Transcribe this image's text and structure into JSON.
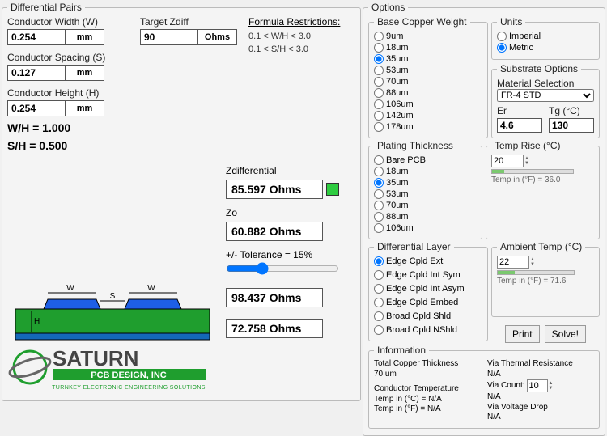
{
  "diffpairs": {
    "legend": "Differential Pairs",
    "conductor_width_label": "Conductor Width (W)",
    "conductor_width_value": "0.254",
    "conductor_width_unit": "mm",
    "target_zdiff_label": "Target Zdiff",
    "target_zdiff_value": "90",
    "target_zdiff_unit": "Ohms",
    "conductor_spacing_label": "Conductor Spacing (S)",
    "conductor_spacing_value": "0.127",
    "conductor_spacing_unit": "mm",
    "conductor_height_label": "Conductor Height (H)",
    "conductor_height_value": "0.254",
    "conductor_height_unit": "mm",
    "formula_header": "Formula Restrictions:",
    "formula_line1": "0.1 < W/H < 3.0",
    "formula_line2": "0.1 < S/H < 3.0",
    "wh_ratio": "W/H = 1.000",
    "sh_ratio": "S/H =  0.500",
    "zdiff_label": "Zdifferential",
    "zdiff_value": "85.597 Ohms",
    "zo_label": "Zo",
    "zo_value": "60.882 Ohms",
    "tolerance_label": "+/- Tolerance = 15%",
    "upper_value": "98.437 Ohms",
    "lower_value": "72.758 Ohms"
  },
  "options": {
    "legend": "Options",
    "base_copper_legend": "Base Copper Weight",
    "base_copper_items": [
      "9um",
      "18um",
      "35um",
      "53um",
      "70um",
      "88um",
      "106um",
      "142um",
      "178um"
    ],
    "base_copper_selected": "35um",
    "units_legend": "Units",
    "units_items": [
      "Imperial",
      "Metric"
    ],
    "units_selected": "Metric",
    "substrate_legend": "Substrate Options",
    "material_label": "Material Selection",
    "material_value": "FR-4 STD",
    "er_label": "Er",
    "er_value": "4.6",
    "tg_label": "Tg (°C)",
    "tg_value": "130",
    "plating_legend": "Plating Thickness",
    "plating_items": [
      "Bare PCB",
      "18um",
      "35um",
      "53um",
      "70um",
      "88um",
      "106um"
    ],
    "plating_selected": "35um",
    "temp_rise_legend": "Temp Rise (°C)",
    "temp_rise_value": "20",
    "temp_rise_note": "Temp in (°F) = 36.0",
    "diff_layer_legend": "Differential Layer",
    "diff_layer_items": [
      "Edge Cpld Ext",
      "Edge Cpld Int Sym",
      "Edge Cpld Int Asym",
      "Edge Cpld Embed",
      "Broad Cpld Shld",
      "Broad Cpld NShld"
    ],
    "diff_layer_selected": "Edge Cpld Ext",
    "ambient_legend": "Ambient Temp (°C)",
    "ambient_value": "22",
    "ambient_note": "Temp in (°F) = 71.6",
    "print_label": "Print",
    "solve_label": "Solve!",
    "info_legend": "Information",
    "info_total_copper_label": "Total Copper Thickness",
    "info_total_copper_value": "70 um",
    "info_via_thermal_label": "Via Thermal Resistance",
    "info_via_thermal_value": "N/A",
    "info_via_count_label": "Via Count:",
    "info_via_count_value": "10",
    "info_cond_temp_label": "Conductor Temperature",
    "info_temp_c": "Temp in (°C) = N/A",
    "info_temp_f": "Temp in (°F) = N/A",
    "info_na": "N/A",
    "info_via_voltage_label": "Via Voltage Drop",
    "info_via_voltage_value": "N/A"
  },
  "logo": {
    "company": "SATURN",
    "sub1": "PCB DESIGN, INC",
    "sub2": "TURNKEY ELECTRONIC ENGINEERING SOLUTIONS"
  }
}
